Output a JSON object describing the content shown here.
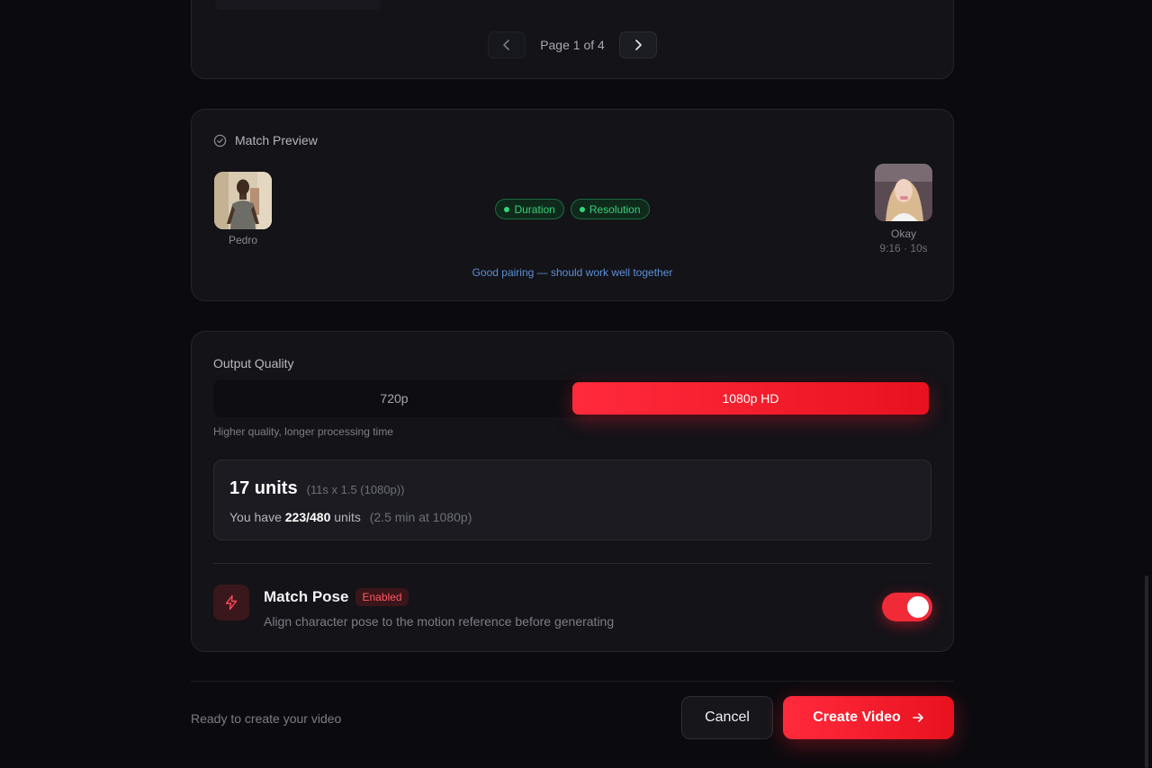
{
  "pagination": {
    "label": "Page 1 of 4"
  },
  "match_preview": {
    "title": "Match Preview",
    "character": {
      "name": "Pedro"
    },
    "motion": {
      "name": "Okay",
      "meta": "9:16 · 10s"
    },
    "badges": [
      {
        "label": "Duration"
      },
      {
        "label": "Resolution"
      }
    ],
    "note": "Good pairing — should work well together"
  },
  "output_quality": {
    "title": "Output Quality",
    "options": [
      {
        "label": "720p",
        "selected": false
      },
      {
        "label": "1080p HD",
        "selected": true
      }
    ],
    "hint": "Higher quality, longer processing time",
    "cost": {
      "value": "17 units",
      "calc": "(11s x 1.5 (1080p))",
      "prefix": "You have",
      "balance": "223/480",
      "suffix": "units",
      "extra": "(2.5 min at 1080p)"
    },
    "match_pose": {
      "title": "Match Pose",
      "badge": "Enabled",
      "description": "Align character pose to the motion reference before generating",
      "enabled": true
    }
  },
  "footer": {
    "status": "Ready to create your video",
    "cancel_label": "Cancel",
    "create_label": "Create Video"
  },
  "colors": {
    "accent": "#f12a38",
    "success": "#30d67a",
    "link": "#5f8fd6"
  }
}
